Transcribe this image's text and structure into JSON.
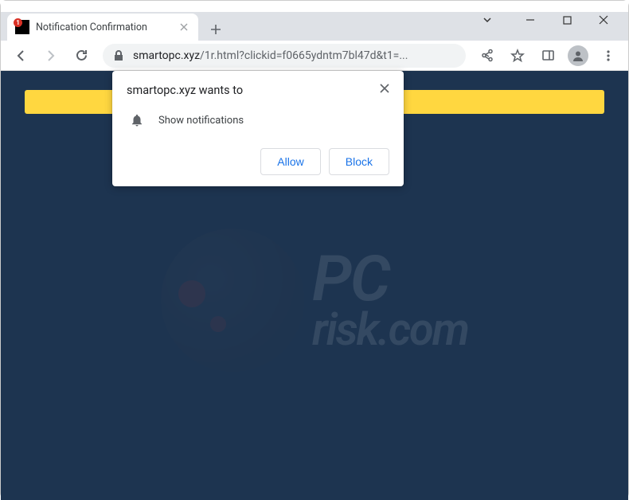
{
  "window": {
    "tab_title": "Notification Confirmation",
    "favicon_badge": "1"
  },
  "toolbar": {
    "url_domain": "smartopc.xyz",
    "url_path": "/1r.html?clickid=f0665ydntm7bl47d&t1=..."
  },
  "popup": {
    "title_prefix": "smartopc.xyz",
    "title_suffix": " wants to",
    "permission_label": "Show notifications",
    "allow_label": "Allow",
    "block_label": "Block"
  },
  "watermark": {
    "line1": "PC",
    "line2": "risk.com"
  }
}
